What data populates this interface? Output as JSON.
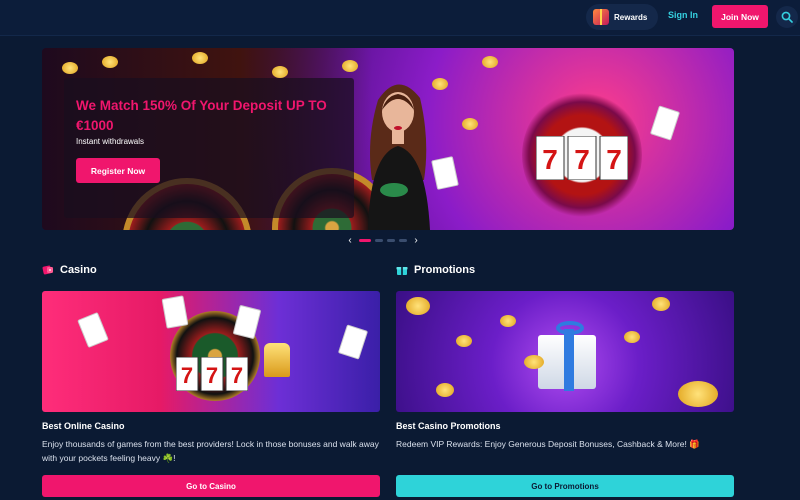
{
  "header": {
    "rewards_label": "Rewards",
    "signin_label": "Sign In",
    "join_label": "Join Now"
  },
  "hero": {
    "title": "We Match 150% Of Your Deposit UP TO €1000",
    "subtitle": "Instant withdrawals",
    "cta_label": "Register Now",
    "carousel": {
      "prev": "‹",
      "next": "›",
      "slides": 4,
      "active": 1
    }
  },
  "sections": {
    "casino": {
      "heading": "Casino",
      "card_title": "Best Online Casino",
      "card_desc": "Enjoy thousands of games from the best providers! Lock in those bonuses and walk away with your pockets feeling heavy ☘️!",
      "cta_label": "Go to Casino"
    },
    "promotions": {
      "heading": "Promotions",
      "card_title": "Best Casino Promotions",
      "card_desc": "Redeem VIP Rewards: Enjoy Generous Deposit Bonuses, Cashback & More! 🎁",
      "cta_label": "Go to Promotions"
    }
  },
  "colors": {
    "background": "#0b1a33",
    "accent_pink": "#f0166d",
    "accent_teal": "#2ed3d9",
    "link_teal": "#35d0e0"
  },
  "icons": {
    "rewards": "gift-icon",
    "search": "search-icon",
    "casino": "dice-icon",
    "promotions": "gift-box-icon"
  }
}
